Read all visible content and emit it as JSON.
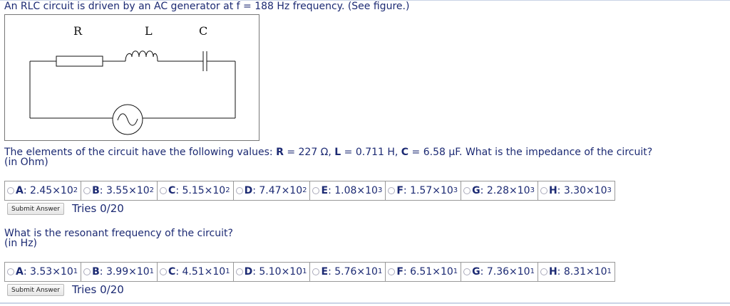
{
  "problem": {
    "intro": "An RLC circuit is driven by an AC generator at f = 188 Hz frequency. (See figure.)"
  },
  "figure": {
    "labels": {
      "R": "R",
      "L": "L",
      "C": "C"
    },
    "components": [
      "resistor",
      "inductor",
      "capacitor",
      "ac-source"
    ]
  },
  "question1": {
    "text_prefix": "The elements of the circuit have the following values: ",
    "r_label": "R",
    "r_value": " = 227 Ω, ",
    "l_label": "L",
    "l_value": " = 0.711 H, ",
    "c_label": "C",
    "c_value": " = 6.58 μF. What is the impedance of the circuit?",
    "unit": "(in Ohm)",
    "choices": [
      {
        "letter": "A",
        "mantissa": "2.45",
        "times": "×10",
        "exp": "2"
      },
      {
        "letter": "B",
        "mantissa": "3.55",
        "times": "×10",
        "exp": "2"
      },
      {
        "letter": "C",
        "mantissa": "5.15",
        "times": "×10",
        "exp": "2"
      },
      {
        "letter": "D",
        "mantissa": "7.47",
        "times": "×10",
        "exp": "2"
      },
      {
        "letter": "E",
        "mantissa": "1.08",
        "times": "×10",
        "exp": "3"
      },
      {
        "letter": "F",
        "mantissa": "1.57",
        "times": "×10",
        "exp": "3"
      },
      {
        "letter": "G",
        "mantissa": "2.28",
        "times": "×10",
        "exp": "3"
      },
      {
        "letter": "H",
        "mantissa": "3.30",
        "times": "×10",
        "exp": "3"
      }
    ],
    "submit_label": "Submit Answer",
    "tries": "Tries 0/20"
  },
  "question2": {
    "text": "What is the resonant frequency of the circuit?",
    "unit": "(in Hz)",
    "choices": [
      {
        "letter": "A",
        "mantissa": "3.53",
        "times": "×10",
        "exp": "1"
      },
      {
        "letter": "B",
        "mantissa": "3.99",
        "times": "×10",
        "exp": "1"
      },
      {
        "letter": "C",
        "mantissa": "4.51",
        "times": "×10",
        "exp": "1"
      },
      {
        "letter": "D",
        "mantissa": "5.10",
        "times": "×10",
        "exp": "1"
      },
      {
        "letter": "E",
        "mantissa": "5.76",
        "times": "×10",
        "exp": "1"
      },
      {
        "letter": "F",
        "mantissa": "6.51",
        "times": "×10",
        "exp": "1"
      },
      {
        "letter": "G",
        "mantissa": "7.36",
        "times": "×10",
        "exp": "1"
      },
      {
        "letter": "H",
        "mantissa": "8.31",
        "times": "×10",
        "exp": "1"
      }
    ],
    "submit_label": "Submit Answer",
    "tries": "Tries 0/20"
  }
}
